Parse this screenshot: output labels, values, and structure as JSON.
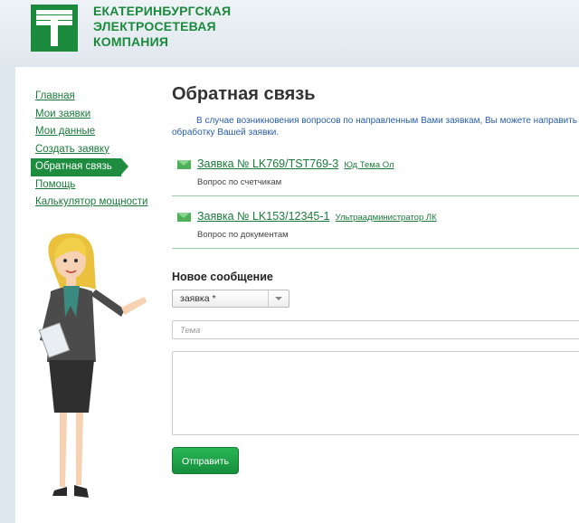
{
  "header": {
    "logo_lines": [
      "ЕКАТЕРИНБУРГСКАЯ",
      "ЭЛЕКТРОСЕТЕВАЯ",
      "КОМПАНИЯ"
    ],
    "brand_color": "#1b8a3c"
  },
  "sidebar": {
    "items": [
      {
        "label": "Главная",
        "active": false
      },
      {
        "label": "Мои заявки",
        "active": false
      },
      {
        "label": "Мои данные",
        "active": false
      },
      {
        "label": "Создать заявку",
        "active": false
      },
      {
        "label": "Обратная связь",
        "active": true
      },
      {
        "label": "Помощь",
        "active": false
      },
      {
        "label": "Калькулятор мощности",
        "active": false
      }
    ]
  },
  "main": {
    "title": "Обратная связь",
    "intro": "В случае возникновения вопросов по направленным Вами заявкам, Вы можете направить о обработку Вашей заявки.",
    "messages": [
      {
        "request": "Заявка № LK769/TST769-3",
        "author": "Юд Тема Ол",
        "subject": "Вопрос по счетчикам",
        "icon": "envelope-icon"
      },
      {
        "request": "Заявка № LK153/12345-1",
        "author": "Ультраадминистратор ЛК",
        "subject": "Вопрос по документам",
        "icon": "envelope-icon"
      }
    ]
  },
  "form": {
    "heading": "Новое сообщение",
    "select_value": "заявка *",
    "topic_placeholder": "Тема",
    "message_value": "",
    "submit_label": "Отправить"
  }
}
